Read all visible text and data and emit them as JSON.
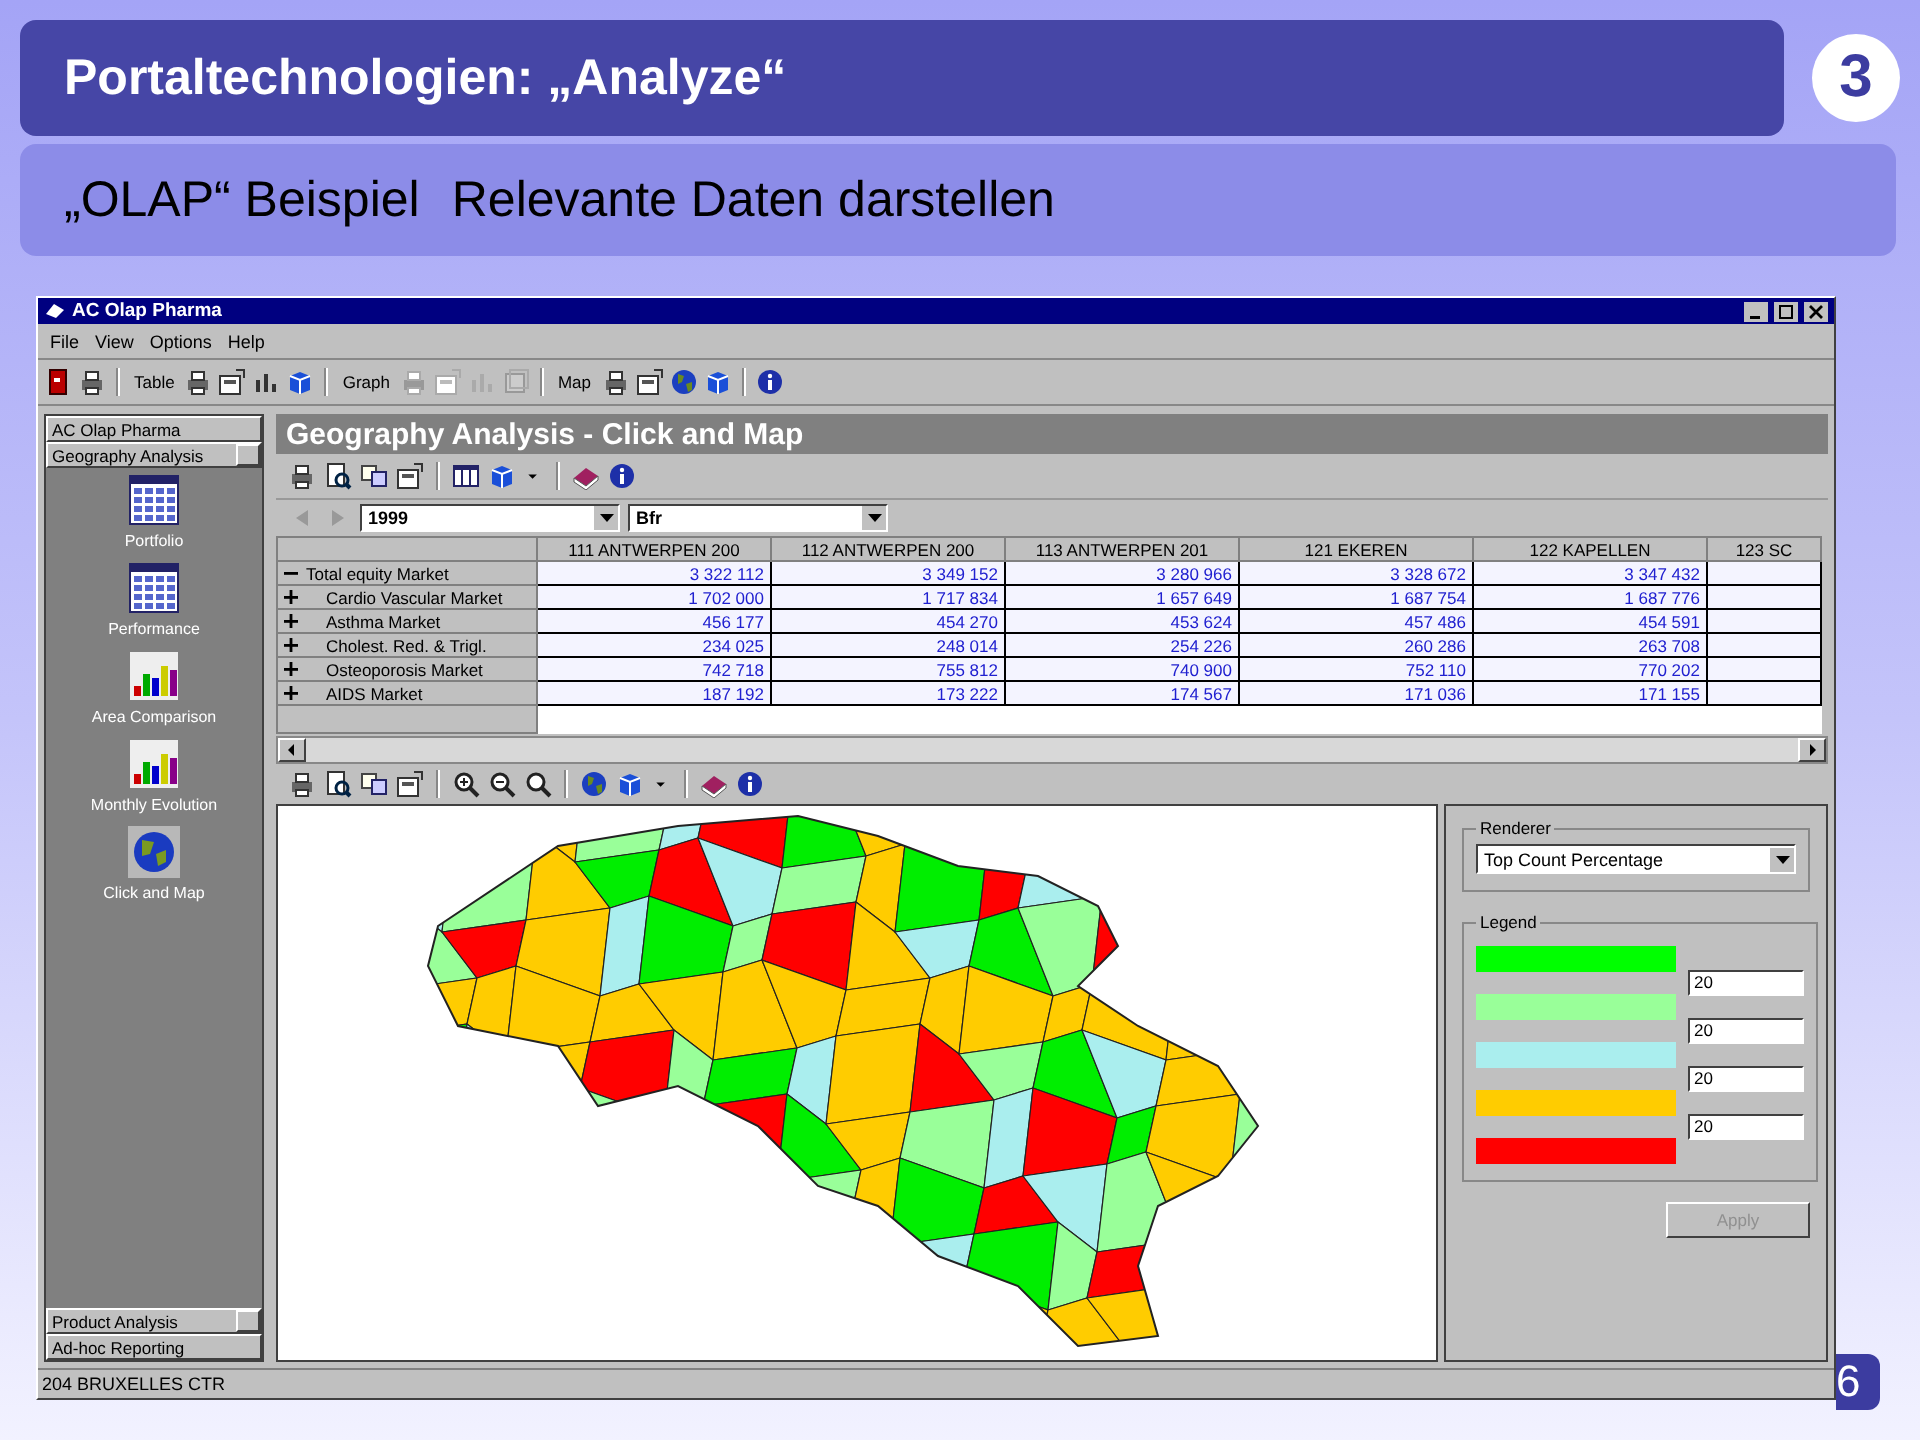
{
  "slide": {
    "title": "Portaltechnologien: „Analyze“",
    "badge": "3",
    "subtitles": [
      "„OLAP“ Beispiel",
      "Relevante Daten darstellen"
    ],
    "page_number": "6"
  },
  "window": {
    "title": "AC Olap Pharma",
    "menu": [
      "File",
      "View",
      "Options",
      "Help"
    ],
    "toolbar_groups": [
      {
        "label": "Table",
        "disabled": false
      },
      {
        "label": "Graph",
        "disabled": true
      },
      {
        "label": "Map",
        "disabled": false
      }
    ]
  },
  "sidebar": {
    "top_sections": [
      {
        "label": "AC Olap Pharma",
        "has_button": false
      },
      {
        "label": "Geography Analysis",
        "has_button": true
      }
    ],
    "items": [
      {
        "label": "Portfolio",
        "kind": "grid"
      },
      {
        "label": "Performance",
        "kind": "grid"
      },
      {
        "label": "Area Comparison",
        "kind": "bars"
      },
      {
        "label": "Monthly Evolution",
        "kind": "bars"
      },
      {
        "label": "Click and Map",
        "kind": "globe"
      }
    ],
    "bottom_sections": [
      {
        "label": "Product Analysis",
        "has_button": true
      },
      {
        "label": "Ad-hoc Reporting",
        "has_button": false
      }
    ]
  },
  "view": {
    "title": "Geography Analysis - Click and Map",
    "year": "1999",
    "currency": "Bfr"
  },
  "table": {
    "columns": [
      "111 ANTWERPEN 200",
      "112 ANTWERPEN 200",
      "113 ANTWERPEN 201",
      "121 EKEREN",
      "122 KAPELLEN",
      "123 SC"
    ],
    "rows": [
      {
        "label": "Total equity Market",
        "expanded": true,
        "values": [
          "3 322 112",
          "3 349 152",
          "3 280 966",
          "3 328 672",
          "3 347 432"
        ],
        "children": [
          {
            "label": "Cardio Vascular Market",
            "expanded": false,
            "values": [
              "1 702 000",
              "1 717 834",
              "1 657 649",
              "1 687 754",
              "1 687 776"
            ]
          },
          {
            "label": "Asthma Market",
            "expanded": false,
            "values": [
              "456 177",
              "454 270",
              "453 624",
              "457 486",
              "454 591"
            ]
          },
          {
            "label": "Cholest. Red. & Trigl.",
            "expanded": false,
            "values": [
              "234 025",
              "248 014",
              "254 226",
              "260 286",
              "263 708"
            ]
          },
          {
            "label": "Osteoporosis Market",
            "expanded": false,
            "values": [
              "742 718",
              "755 812",
              "740 900",
              "752 110",
              "770 202"
            ]
          },
          {
            "label": "AIDS Market",
            "expanded": false,
            "values": [
              "187 192",
              "173 222",
              "174 567",
              "171 036",
              "171 155"
            ]
          }
        ]
      }
    ]
  },
  "renderer": {
    "title": "Renderer",
    "value": "Top Count Percentage"
  },
  "legend": {
    "title": "Legend",
    "items": [
      {
        "color": "#00ff00"
      },
      {
        "color": "#99ff99"
      },
      {
        "color": "#aaeeee"
      },
      {
        "color": "#ffcc00"
      },
      {
        "color": "#ff0000"
      }
    ],
    "thresholds": [
      "20",
      "20",
      "20",
      "20"
    ]
  },
  "apply_button": {
    "label": "Apply",
    "disabled": true
  },
  "status_bar": "204 BRUXELLES CTR"
}
